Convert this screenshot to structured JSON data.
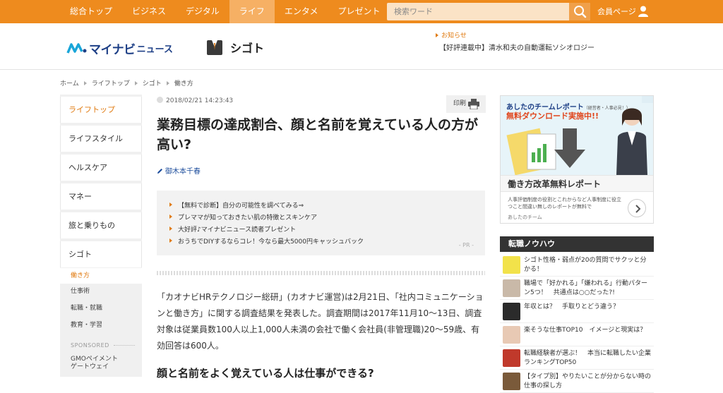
{
  "nav": {
    "tabs": [
      {
        "label": "総合トップ"
      },
      {
        "label": "ビジネス"
      },
      {
        "label": "デジタル"
      },
      {
        "label": "ライフ"
      },
      {
        "label": "エンタメ"
      },
      {
        "label": "プレゼント"
      }
    ],
    "active_tab": "ライフ",
    "search_placeholder": "検索ワード",
    "member_label": "会員ページ"
  },
  "header": {
    "logo_main": "マイナビ",
    "logo_sub": "ニュース",
    "section_logo": "シゴト",
    "notice_label": "お知らせ",
    "notice_text": "【好評連載中】清水和夫の自動運転ソシオロジー"
  },
  "breadcrumb": [
    "ホーム",
    "ライフトップ",
    "シゴト",
    "働き方"
  ],
  "sidebar": {
    "items": [
      {
        "label": "ライフトップ"
      },
      {
        "label": "ライフスタイル"
      },
      {
        "label": "ヘルスケア"
      },
      {
        "label": "マネー"
      },
      {
        "label": "旅と乗りもの"
      },
      {
        "label": "シゴト"
      }
    ],
    "sub_items": [
      {
        "label": "働き方"
      },
      {
        "label": "仕事術"
      },
      {
        "label": "転職・就職"
      },
      {
        "label": "教育・学習"
      }
    ],
    "sponsored_label": "SPONSORED",
    "sponsored_item_line1": "GMOペイメント",
    "sponsored_item_line2": "ゲートウェイ"
  },
  "article": {
    "date": "2018/02/21 14:23:43",
    "print_label": "印刷",
    "title": "業務目標の達成割合、顔と名前を覚えている人の方が高い?",
    "author": "御木本千春",
    "pr_links": [
      {
        "label": "【無料で診断】自分の可能性を調べてみる⇒"
      },
      {
        "label": "プレママが知っておきたい肌の特徴とスキンケア"
      },
      {
        "label": "大好評♪マイナビニュース読者プレゼント"
      },
      {
        "label": "おうちでDIYするならコレ！今なら最大5000円キャッシュバック"
      }
    ],
    "pr_tag": "- PR -",
    "body": "「カオナビHRテクノロジー総研」(カオナビ運営)は2月21日、「社内コミュニケーションと働き方」に関する調査結果を発表した。調査期間は2017年11月10〜13日、調査対象は従業員数100人以上1,000人未満の会社で働く会社員(非管理職)20〜59歳、有効回答は600人。",
    "subhead": "顔と名前をよく覚えている人は仕事ができる?"
  },
  "ad": {
    "headline": "あしたのチームレポート",
    "headline_small": "（経営者・人事必見！）",
    "cta": "無料ダウンロード実施中!!",
    "bar_title": "働き方改革無料レポート",
    "description": "人事評価制度の役割とこれからなど人事制度に役立つこと間違い無しのレポートが無料で",
    "source": "あしたのチーム"
  },
  "knowhow": {
    "heading": "転職ノウハウ",
    "items": [
      {
        "label": "シゴト性格・弱点が20の質問でサクッと分かる！",
        "thumb_color": "#f2e24a"
      },
      {
        "label": "職場で「好かれる」「嫌われる」行動パターン5つ！　共通点は○○だった?!",
        "thumb_color": "#c9b9a8"
      },
      {
        "label": "年収とは？　手取りとどう違う？",
        "thumb_color": "#2b2b2b"
      },
      {
        "label": "楽そうな仕事TOP10　イメージと現実は？",
        "thumb_color": "#e8c9b4"
      },
      {
        "label": "転職経験者が選ぶ！　本当に転職したい企業ランキングTOP50",
        "thumb_color": "#c0392b"
      },
      {
        "label": "【タイプ別】やりたいことが分からない時の仕事の探し方",
        "thumb_color": "#7a5a3a"
      }
    ]
  },
  "colors": {
    "nav_orange": "#ee8b1e",
    "accent": "#e07a10",
    "brand_blue": "#1d3f86"
  }
}
